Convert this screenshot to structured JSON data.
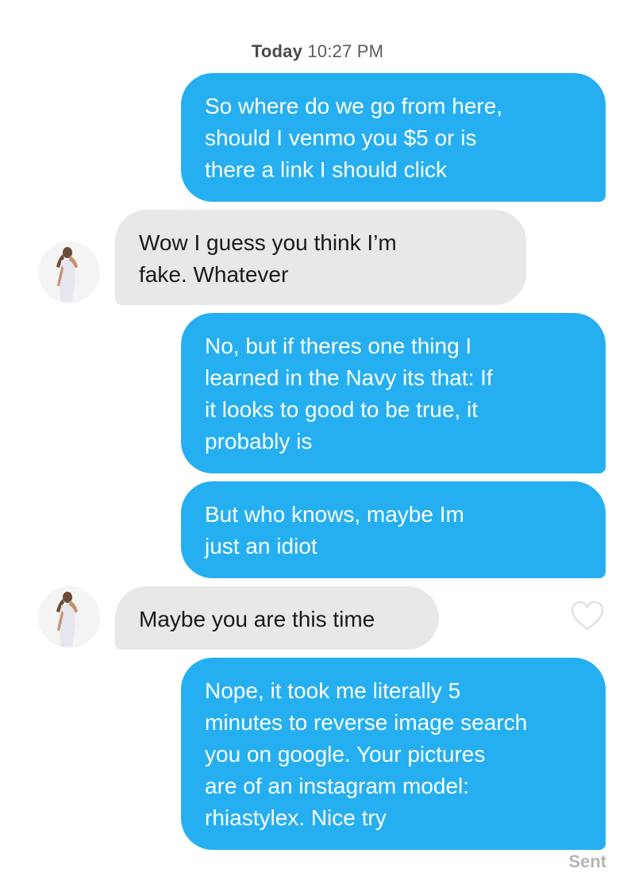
{
  "header": {
    "day": "Today",
    "time": "10:27 PM"
  },
  "messages": [
    {
      "from": "me",
      "text": "So where do we go from here,\nshould I venmo you $5 or is\nthere a link I should click"
    },
    {
      "from": "them",
      "text": "Wow I guess you think I’m\nfake. Whatever"
    },
    {
      "from": "me",
      "text": "No, but if theres one thing I\nlearned in the Navy its that: If\nit looks to good to be true, it\nprobably is"
    },
    {
      "from": "me",
      "text": "But who knows, maybe Im\njust an idiot"
    },
    {
      "from": "them",
      "text": "Maybe you are this time",
      "like_icon": "heart-outline-icon"
    },
    {
      "from": "me",
      "text": "Nope, it took me literally 5\nminutes to reverse image search\nyou on google. Your pictures\nare of an instagram model:\nrhiastylex. Nice try"
    }
  ],
  "footer": {
    "status": "Sent"
  },
  "colors": {
    "outgoing": "#25aff0",
    "incoming": "#e8e8e8",
    "sent_text": "#b5b5b5"
  }
}
